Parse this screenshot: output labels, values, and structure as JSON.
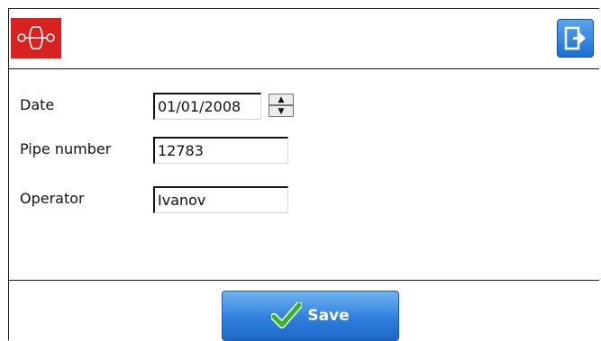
{
  "header": {
    "logo_alt": "valve-logo",
    "exit_icon": "exit-icon"
  },
  "form": {
    "date": {
      "label": "Date",
      "value": "01/01/2008"
    },
    "pipe_number": {
      "label": "Pipe number",
      "value": "12783"
    },
    "operator": {
      "label": "Operator",
      "value": "Ivanov"
    }
  },
  "footer": {
    "save_label": "Save",
    "save_icon": "checkmark-icon"
  },
  "colors": {
    "logo_bg": "#d7221f",
    "button_blue": "#2f7fdc",
    "check_green": "#3bb22f"
  }
}
